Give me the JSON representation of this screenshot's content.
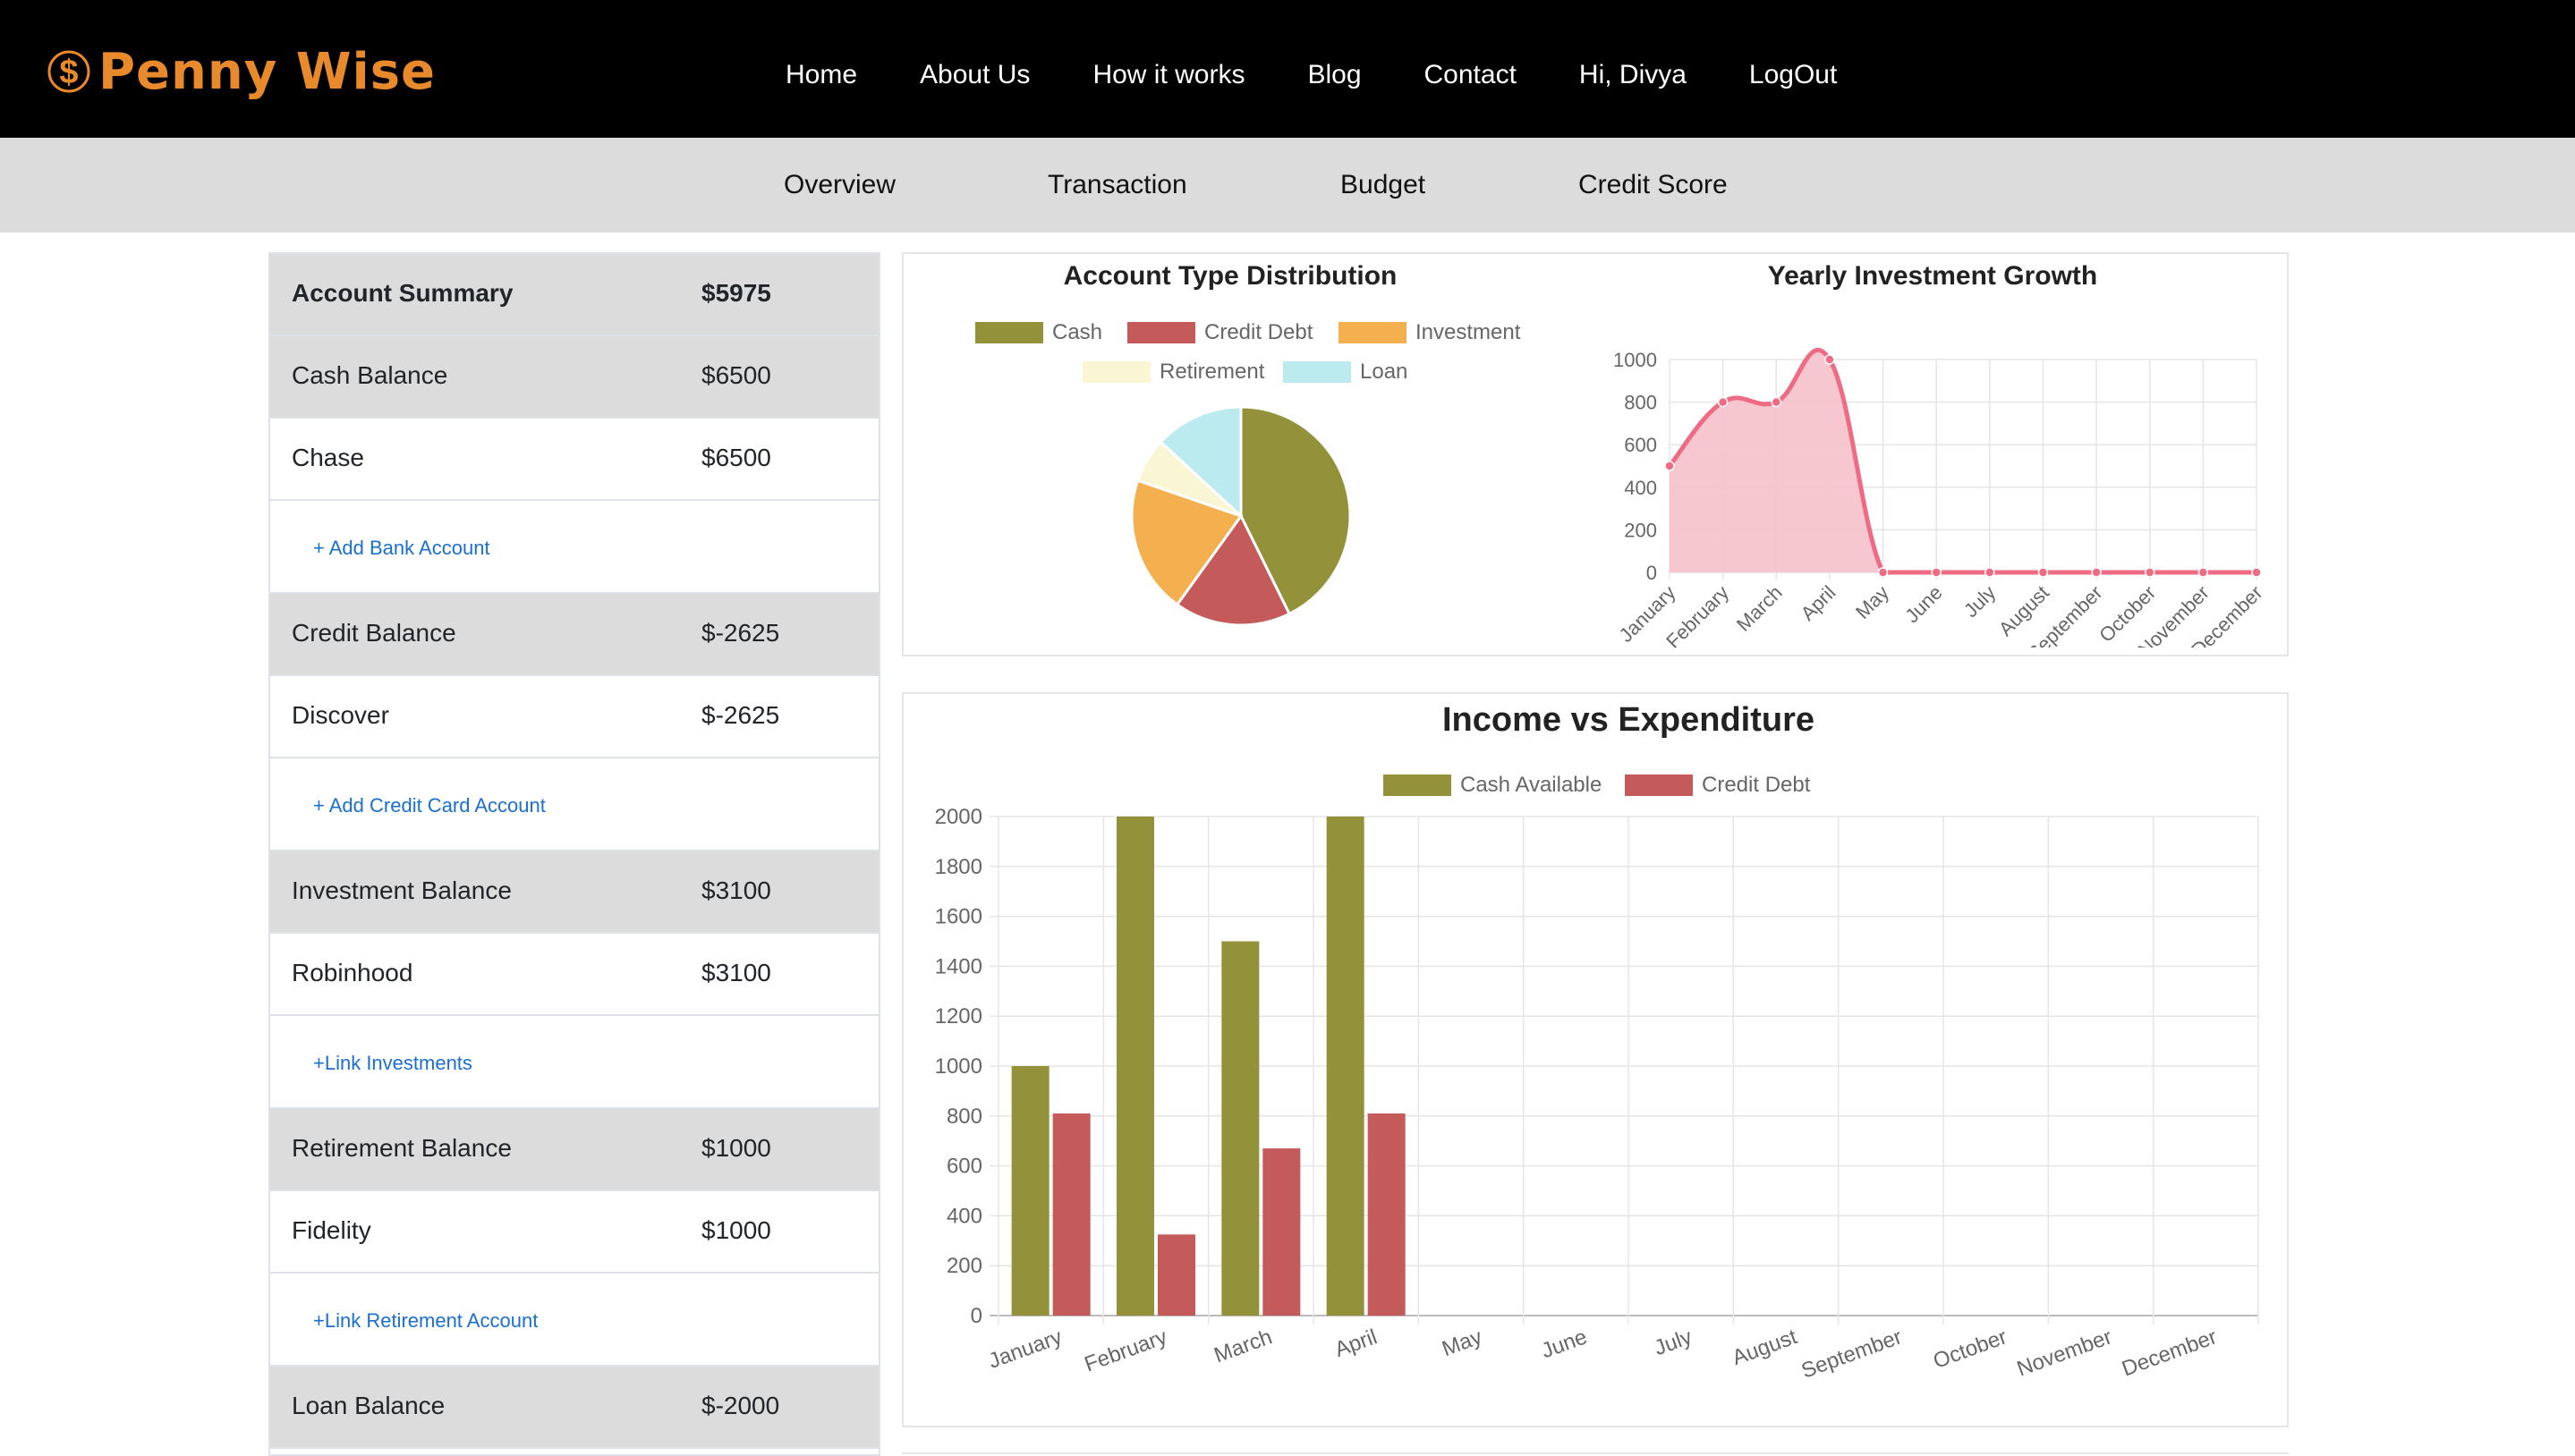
{
  "brand": {
    "name": "Penny Wise",
    "color": "#e8892c"
  },
  "nav": [
    "Home",
    "About Us",
    "How it works",
    "Blog",
    "Contact",
    "Hi, Divya",
    "LogOut"
  ],
  "subnav": [
    "Overview",
    "Transaction",
    "Budget",
    "Credit Score"
  ],
  "summary": {
    "header": {
      "label": "Account Summary",
      "value": "$5975"
    },
    "rows": [
      {
        "type": "group",
        "label": "Cash Balance",
        "value": "$6500"
      },
      {
        "type": "item",
        "label": "Chase",
        "value": "$6500"
      },
      {
        "type": "link",
        "label": "+ Add Bank Account"
      },
      {
        "type": "group",
        "label": "Credit Balance",
        "value": "$-2625"
      },
      {
        "type": "item",
        "label": "Discover",
        "value": "$-2625"
      },
      {
        "type": "link",
        "label": "+ Add Credit Card Account"
      },
      {
        "type": "group",
        "label": "Investment Balance",
        "value": "$3100"
      },
      {
        "type": "item",
        "label": "Robinhood",
        "value": "$3100"
      },
      {
        "type": "link",
        "label": "+Link Investments"
      },
      {
        "type": "group",
        "label": "Retirement Balance",
        "value": "$1000"
      },
      {
        "type": "item",
        "label": "Fidelity",
        "value": "$1000"
      },
      {
        "type": "link",
        "label": "+Link Retirement Account"
      },
      {
        "type": "group",
        "label": "Loan Balance",
        "value": "$-2000"
      }
    ]
  },
  "chart_data": [
    {
      "type": "pie",
      "title": "Account Type Distribution",
      "labels": [
        "Cash",
        "Credit Debt",
        "Investment",
        "Retirement",
        "Loan"
      ],
      "values": [
        6500,
        2625,
        3100,
        1000,
        2000
      ],
      "colors": [
        "#939139",
        "#c55a5a",
        "#f4b04f",
        "#faf5d2",
        "#bcebef"
      ]
    },
    {
      "type": "line",
      "title": "Yearly Investment Growth",
      "categories": [
        "January",
        "February",
        "March",
        "April",
        "May",
        "June",
        "July",
        "August",
        "September",
        "October",
        "November",
        "December"
      ],
      "values": [
        500,
        800,
        800,
        1000,
        0,
        0,
        0,
        0,
        0,
        0,
        0,
        0
      ],
      "ylim": [
        0,
        1000
      ],
      "yticks": [
        0,
        200,
        400,
        600,
        800,
        1000
      ],
      "line_color": "#ef6a83",
      "fill_color": "#f6c1cb",
      "grid": true
    },
    {
      "type": "bar",
      "title": "Income vs Expenditure",
      "categories": [
        "January",
        "February",
        "March",
        "April",
        "May",
        "June",
        "July",
        "August",
        "September",
        "October",
        "November",
        "December"
      ],
      "series": [
        {
          "name": "Cash Available",
          "color": "#939139",
          "values": [
            1000,
            2000,
            1500,
            2000,
            0,
            0,
            0,
            0,
            0,
            0,
            0,
            0
          ]
        },
        {
          "name": "Credit Debt",
          "color": "#c55a5a",
          "values": [
            810,
            325,
            670,
            810,
            0,
            0,
            0,
            0,
            0,
            0,
            0,
            0
          ]
        }
      ],
      "ylim": [
        0,
        2000
      ],
      "yticks": [
        0,
        200,
        400,
        600,
        800,
        1000,
        1200,
        1400,
        1600,
        1800,
        2000
      ],
      "legend": "top",
      "grid": true
    }
  ]
}
